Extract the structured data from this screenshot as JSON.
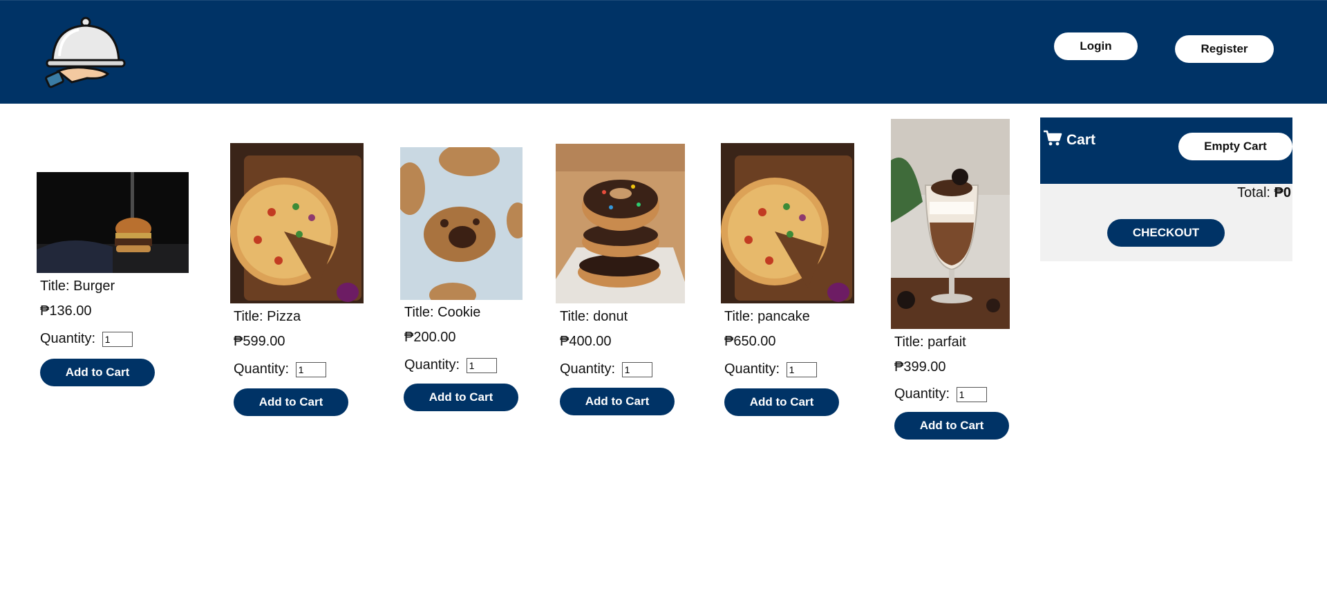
{
  "header": {
    "login_label": "Login",
    "register_label": "Register",
    "logo_icon": "serving-cloche-icon"
  },
  "colors": {
    "brand": "#003366",
    "cart_panel_bg": "#f1f1f1"
  },
  "products": [
    {
      "title": "Title: Burger",
      "price": "₱136.00",
      "quantity_label": "Quantity:",
      "quantity": "1",
      "button": "Add to Cart"
    },
    {
      "title": "Title: Pizza",
      "price": "₱599.00",
      "quantity_label": "Quantity:",
      "quantity": "1",
      "button": "Add to Cart"
    },
    {
      "title": "Title: Cookie",
      "price": "₱200.00",
      "quantity_label": "Quantity:",
      "quantity": "1",
      "button": "Add to Cart"
    },
    {
      "title": "Title: donut",
      "price": "₱400.00",
      "quantity_label": "Quantity:",
      "quantity": "1",
      "button": "Add to Cart"
    },
    {
      "title": "Title: pancake",
      "price": "₱650.00",
      "quantity_label": "Quantity:",
      "quantity": "1",
      "button": "Add to Cart"
    },
    {
      "title": "Title: parfait",
      "price": "₱399.00",
      "quantity_label": "Quantity:",
      "quantity": "1",
      "button": "Add to Cart"
    }
  ],
  "cart": {
    "icon": "shopping-cart-icon",
    "title": "Cart",
    "empty_label": "Empty Cart",
    "total_label": "Total:",
    "total_value": "₱0",
    "checkout_label": "CHECKOUT"
  }
}
